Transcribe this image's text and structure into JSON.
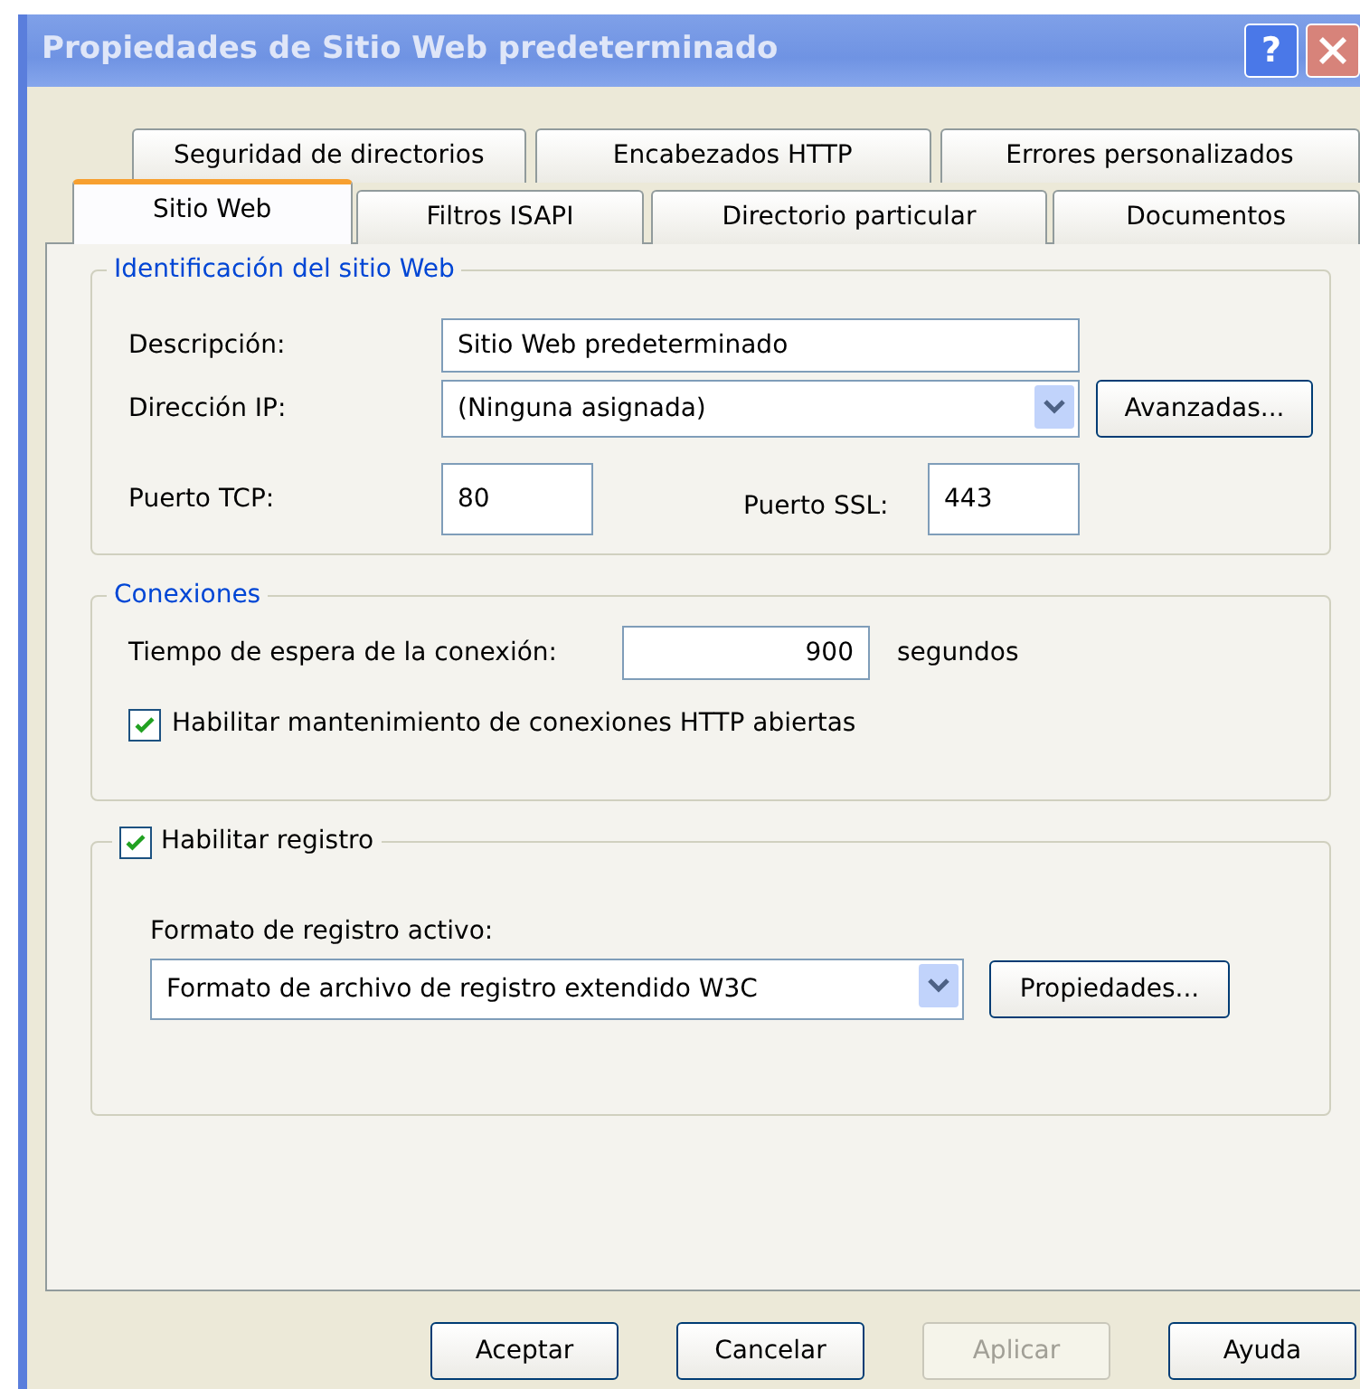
{
  "window": {
    "title": "Propiedades de Sitio Web predeterminado",
    "help_button": "?"
  },
  "tab_rows": [
    [
      {
        "label": "Seguridad de directorios",
        "selected": false
      },
      {
        "label": "Encabezados HTTP",
        "selected": false
      },
      {
        "label": "Errores personalizados",
        "selected": false
      }
    ],
    [
      {
        "label": "Sitio Web",
        "selected": true
      },
      {
        "label": "Filtros ISAPI",
        "selected": false
      },
      {
        "label": "Directorio particular",
        "selected": false
      },
      {
        "label": "Documentos",
        "selected": false
      }
    ]
  ],
  "identification": {
    "title": "Identificación del sitio Web",
    "description_label": "Descripción:",
    "description_value": "Sitio Web predeterminado",
    "ip_label": "Dirección IP:",
    "ip_value": "(Ninguna asignada)",
    "advanced_button": "Avanzadas...",
    "tcp_label": "Puerto TCP:",
    "tcp_value": "80",
    "ssl_label": "Puerto SSL:",
    "ssl_value": "443"
  },
  "connections": {
    "title": "Conexiones",
    "timeout_label": "Tiempo de espera de la conexión:",
    "timeout_value": "900",
    "timeout_unit": "segundos",
    "keepalive": {
      "label": "Habilitar mantenimiento de conexiones HTTP abiertas",
      "checked": true
    }
  },
  "logging": {
    "label": "Habilitar registro",
    "checked": true,
    "format_label": "Formato de registro activo:",
    "format_value": "Formato de archivo de registro extendido W3C",
    "properties_button": "Propiedades..."
  },
  "buttons": [
    {
      "label": "Aceptar",
      "disabled": false
    },
    {
      "label": "Cancelar",
      "disabled": false
    },
    {
      "label": "Aplicar",
      "disabled": true
    },
    {
      "label": "Ayuda",
      "disabled": false
    }
  ]
}
